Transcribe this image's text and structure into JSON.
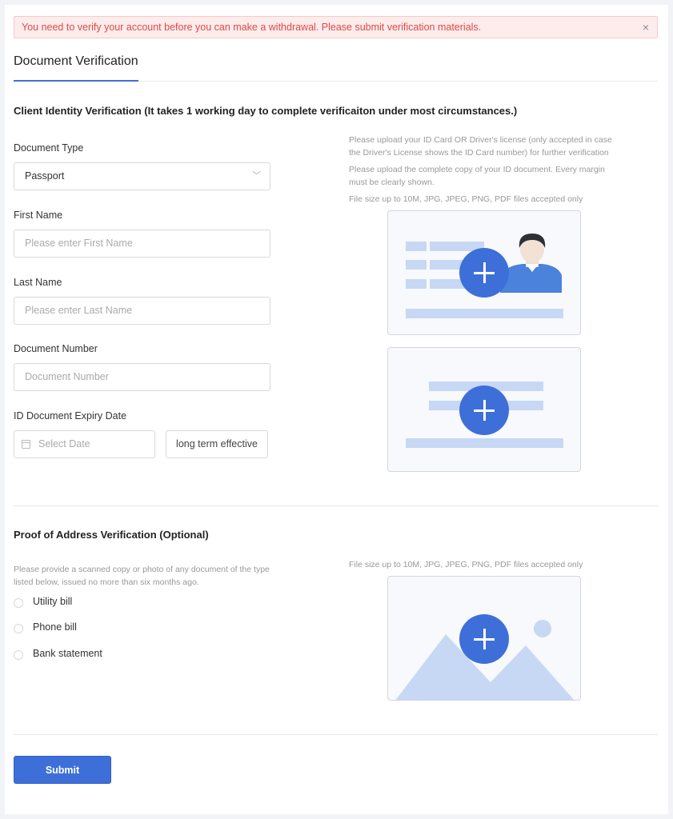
{
  "alert": {
    "message": "You need to verify your account before you can make a withdrawal. Please submit verification materials.",
    "close_icon": "×"
  },
  "tabs": [
    {
      "label": "Document Verification",
      "active": true
    }
  ],
  "identity": {
    "title": "Client Identity Verification (It takes 1 working day to complete verificaiton under most circumstances.)",
    "document_type": {
      "label": "Document Type",
      "value": "Passport",
      "chevron": "﹀"
    },
    "first_name": {
      "label": "First Name",
      "placeholder": "Please enter First Name"
    },
    "last_name": {
      "label": "Last Name",
      "placeholder": "Please enter Last Name"
    },
    "document_number": {
      "label": "Document Number",
      "placeholder": "Document Number"
    },
    "expiry": {
      "label": "ID Document Expiry Date",
      "placeholder": "Select Date",
      "long_term_label": "long term effective"
    },
    "hints": [
      "Please upload your ID Card OR Driver's license (only accepted in case the Driver's License shows the ID Card number) for further verification",
      "Please upload the complete copy of your ID document. Every margin must be clearly shown.",
      "File size up to 10M, JPG, JPEG, PNG, PDF files accepted only"
    ]
  },
  "address": {
    "title": "Proof of Address Verification (Optional)",
    "description": "Please provide a scanned copy or photo of any document of the type listed below, issued no more than six months ago.",
    "hint": "File size up to 10M, JPG, JPEG, PNG, PDF files accepted only",
    "options": [
      "Utility bill",
      "Phone bill",
      "Bank statement"
    ]
  },
  "submit_label": "Submit",
  "colors": {
    "accent": "#3e6fd9",
    "alert_bg": "#fdecec",
    "alert_text": "#e04848",
    "illustration": "#c7d8f4"
  }
}
